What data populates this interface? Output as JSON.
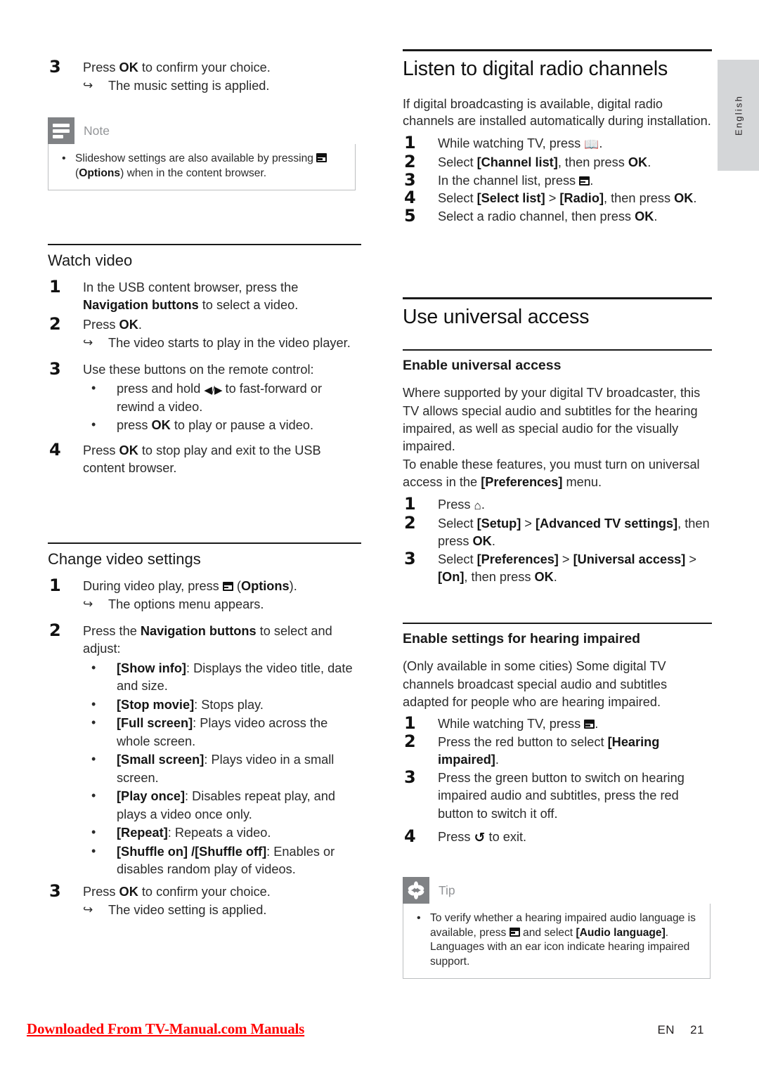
{
  "language_tab": "English",
  "left_column": {
    "step3_music": {
      "num": "3",
      "text_before": "Press ",
      "ok": "OK",
      "text_after": " to confirm your choice.",
      "result": "The music setting is applied."
    },
    "note_callout": {
      "caption": "Note",
      "icon": "note-icon",
      "bullet_parts": {
        "p1": "Slideshow settings are also available by pressing ",
        "icon": "options-icon",
        "p2": " (",
        "bold": "Options",
        "p3": ") when in the content browser."
      }
    },
    "watch_video": {
      "heading": "Watch video",
      "steps": [
        {
          "num": "1",
          "p1": "In the USB content browser, press the ",
          "bold": "Navigation buttons",
          "p2": " to select a video."
        },
        {
          "num": "2",
          "p1": "Press ",
          "bold": "OK",
          "p2": ".",
          "result": "The video starts to play in the video player."
        },
        {
          "num": "3",
          "p1": "Use these buttons on the remote control:",
          "bullets": [
            {
              "p1": "press and hold ",
              "icon": "fast-forward-rewind-icon",
              "p2": " to fast-forward or rewind a video."
            },
            {
              "p1": "press ",
              "bold": "OK",
              "p2": " to play or pause a video."
            }
          ]
        },
        {
          "num": "4",
          "p1": "Press ",
          "bold": "OK",
          "p2": " to stop play and exit to the USB content browser."
        }
      ]
    },
    "change_video_settings": {
      "heading": "Change video settings",
      "steps": [
        {
          "num": "1",
          "p1": "During video play, press ",
          "icon": "options-icon",
          "p2": " (",
          "bold": "Options",
          "p3": ").",
          "result": "The options menu appears."
        },
        {
          "num": "2",
          "p1": "Press the ",
          "bold": "Navigation buttons",
          "p2": " to select and adjust:",
          "bullets": [
            {
              "bold": "[Show info]",
              "rest": ": Displays the video title, date and size."
            },
            {
              "bold": "[Stop movie]",
              "rest": ": Stops play."
            },
            {
              "bold": "[Full screen]",
              "rest": ": Plays video across the whole screen."
            },
            {
              "bold": "[Small screen]",
              "rest": ": Plays video in a small screen."
            },
            {
              "bold": "[Play once]",
              "rest": ": Disables repeat play, and plays a video once only."
            },
            {
              "bold": "[Repeat]",
              "rest": ": Repeats a video."
            },
            {
              "bold": "[Shuffle on] /[Shuffle off]",
              "rest": ": Enables or disables random play of videos."
            }
          ]
        },
        {
          "num": "3",
          "p1": "Press ",
          "bold": "OK",
          "p2": " to confirm your choice.",
          "result": "The video setting is applied."
        }
      ]
    }
  },
  "right_column": {
    "radio": {
      "heading": "Listen to digital radio channels",
      "intro": "If digital broadcasting is available, digital radio channels are installed automatically during installation.",
      "steps": [
        {
          "num": "1",
          "p1": "While watching TV, press ",
          "icon": "book-icon",
          "p2": "."
        },
        {
          "num": "2",
          "p1": "Select ",
          "bold": "[Channel list]",
          "p2": ", then press ",
          "bold2": "OK",
          "p3": "."
        },
        {
          "num": "3",
          "p1": "In the channel list, press ",
          "icon": "options-icon",
          "p2": "."
        },
        {
          "num": "4",
          "p1": "Select ",
          "bold": "[Select list]",
          "mid": " > ",
          "bold2": "[Radio]",
          "p2": ", then press ",
          "bold3": "OK",
          "p3": "."
        },
        {
          "num": "5",
          "p1": "Select a radio channel, then press ",
          "bold": "OK",
          "p2": "."
        }
      ]
    },
    "universal_access": {
      "heading": "Use universal access",
      "enable": {
        "heading": "Enable universal access",
        "para1": "Where supported by your digital TV broadcaster, this TV allows special audio and subtitles for the hearing impaired, as well as special audio for the visually impaired.",
        "para2_p1": "To enable these features, you must turn on universal access in the ",
        "para2_bold": "[Preferences]",
        "para2_p2": " menu.",
        "steps": [
          {
            "num": "1",
            "p1": "Press ",
            "icon": "home-icon",
            "p2": "."
          },
          {
            "num": "2",
            "p1": "Select ",
            "bold": "[Setup]",
            "mid": " > ",
            "bold2": "[Advanced TV settings]",
            "p2": ", then press ",
            "bold3": "OK",
            "p3": "."
          },
          {
            "num": "3",
            "p1": "Select ",
            "bold": "[Preferences]",
            "mid": " > ",
            "bold2": "[Universal access]",
            "mid2": " > ",
            "bold3": "[On]",
            "p2": ", then press ",
            "bold4": "OK",
            "p3": "."
          }
        ]
      },
      "hearing": {
        "heading": "Enable settings for hearing impaired",
        "para": "(Only available in some cities) Some digital TV channels broadcast special audio and subtitles adapted for people who are hearing impaired.",
        "steps": [
          {
            "num": "1",
            "p1": "While watching TV, press ",
            "icon": "options-icon",
            "p2": "."
          },
          {
            "num": "2",
            "p1": "Press the red button to select ",
            "bold": "[Hearing impaired]",
            "p2": "."
          },
          {
            "num": "3",
            "p1": "Press the green button to switch on hearing impaired audio and subtitles, press the red button to switch it off."
          },
          {
            "num": "4",
            "p1": "Press ",
            "icon": "back-icon",
            "p2": " to exit."
          }
        ]
      },
      "tip_callout": {
        "caption": "Tip",
        "icon": "tip-icon",
        "bullet": {
          "p1": "To verify whether a hearing impaired audio language is available, press ",
          "icon": "options-icon",
          "p2": " and select ",
          "bold": "[Audio language]",
          "p3": ". Languages with an ear icon indicate hearing impaired support."
        }
      }
    }
  },
  "footer": {
    "link": "Downloaded From TV-Manual.com Manuals",
    "lang_code": "EN",
    "page_number": "21"
  },
  "colors": {
    "callout_badge": "#808285",
    "callout_caption": "#939598",
    "callout_border": "#bcbec0",
    "lang_tab_bg": "#d4d6d8",
    "footer_link": "#ff0000",
    "text": "#231f20"
  }
}
